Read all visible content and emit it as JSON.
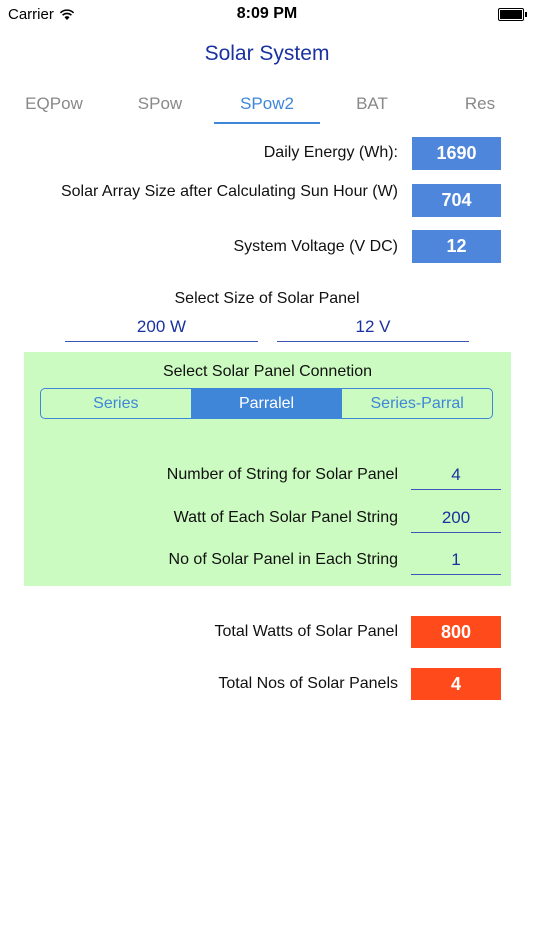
{
  "status_bar": {
    "carrier": "Carrier",
    "time": "8:09 PM",
    "battery_level": 1.0
  },
  "nav": {
    "title": "Solar System"
  },
  "tabs": [
    {
      "label": "EQPow",
      "active": false
    },
    {
      "label": "SPow",
      "active": false
    },
    {
      "label": "SPow2",
      "active": true
    },
    {
      "label": "BAT",
      "active": false
    },
    {
      "label": "Res",
      "active": false
    }
  ],
  "summary": {
    "daily_energy_label": "Daily Energy (Wh):",
    "daily_energy_value": "1690",
    "array_size_label": "Solar Array Size after Calculating Sun Hour (W)",
    "array_size_value": "704",
    "system_voltage_label": "System Voltage (V DC)",
    "system_voltage_value": "12"
  },
  "panel_size": {
    "title": "Select Size of Solar Panel",
    "watt_value": "200 W",
    "volt_value": "12 V"
  },
  "connection": {
    "title": "Select Solar Panel Connetion",
    "options": [
      "Series",
      "Parralel",
      "Series-Parral"
    ],
    "selected": "Parralel",
    "strings_label": "Number of String for Solar Panel",
    "strings_value": "4",
    "watt_string_label": "Watt of Each Solar Panel String",
    "watt_string_value": "200",
    "panels_string_label": "No of Solar Panel in Each String",
    "panels_string_value": "1"
  },
  "totals": {
    "total_watts_label": "Total Watts of Solar Panel",
    "total_watts_value": "800",
    "total_panels_label": "Total Nos of Solar Panels",
    "total_panels_value": "4"
  },
  "colors": {
    "accent": "#3f86d8",
    "value_box": "#4d86db",
    "result_box": "#ff4a1c",
    "panel_bg": "#cbfbc0",
    "title": "#1a32a0"
  }
}
